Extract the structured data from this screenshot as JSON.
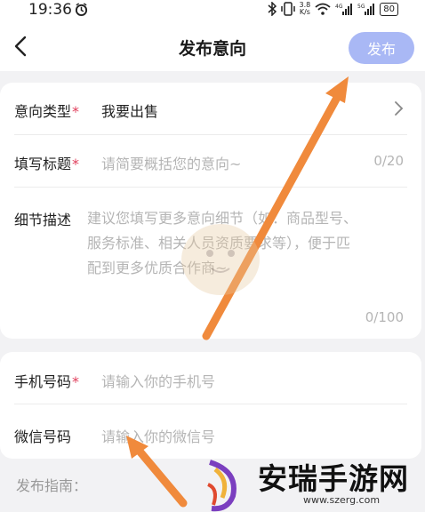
{
  "status_bar": {
    "time": "19:36",
    "net_speed_value": "3.8",
    "net_speed_unit": "K/s",
    "battery": "80"
  },
  "header": {
    "title": "发布意向",
    "publish_label": "发布"
  },
  "form": {
    "intent_type": {
      "label": "意向类型",
      "required": "*",
      "value": "我要出售"
    },
    "title_field": {
      "label": "填写标题",
      "required": "*",
      "placeholder": "请简要概括您的意向~",
      "counter": "0/20"
    },
    "details": {
      "label": "细节描述",
      "placeholder_line1": "建议您填写更多意向细节（如：商品型号、",
      "placeholder_line2": "服务标准、相关人员资质要求等），便于匹",
      "placeholder_line3": "配到更多优质合作商~",
      "counter": "0/100"
    },
    "phone": {
      "label": "手机号码",
      "required": "*",
      "placeholder": "请输入你的手机号"
    },
    "wechat": {
      "label": "微信号码",
      "placeholder": "请输入你的微信号"
    }
  },
  "guide": {
    "label": "发布指南："
  },
  "watermark": {
    "title": "安瑞手游网",
    "url": "www.szerg.com"
  },
  "colors": {
    "accent": "#a9b8f5",
    "required": "#e0405d",
    "arrow": "#f08a3c",
    "placeholder": "#b5b5b5"
  }
}
